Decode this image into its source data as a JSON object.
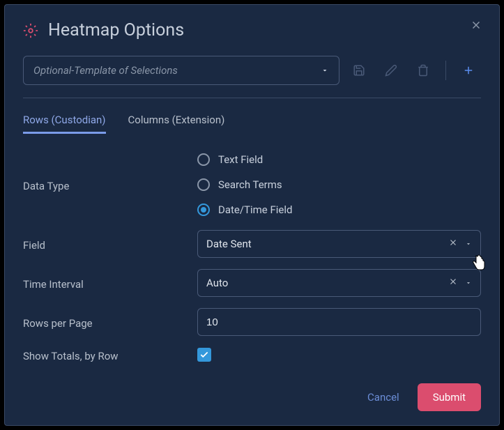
{
  "modal": {
    "title": "Heatmap Options",
    "template_placeholder": "Optional-Template of Selections"
  },
  "tabs": {
    "rows": "Rows (Custodian)",
    "columns": "Columns (Extension)"
  },
  "labels": {
    "data_type": "Data Type",
    "field": "Field",
    "time_interval": "Time Interval",
    "rows_per_page": "Rows per Page",
    "show_totals": "Show Totals, by Row"
  },
  "data_type_options": {
    "text_field": "Text Field",
    "search_terms": "Search Terms",
    "datetime_field": "Date/Time Field"
  },
  "values": {
    "field": "Date Sent",
    "interval": "Auto",
    "rows_per_page": "10",
    "show_totals": true
  },
  "buttons": {
    "cancel": "Cancel",
    "submit": "Submit"
  }
}
